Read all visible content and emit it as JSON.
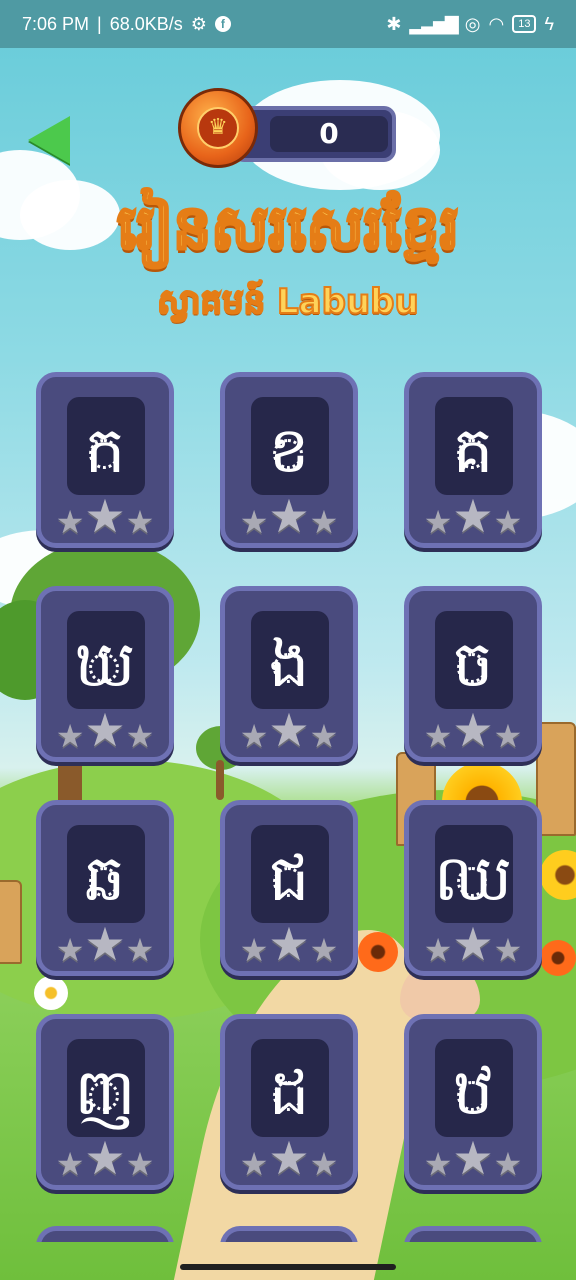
{
  "status_bar": {
    "time": "7:06 PM",
    "separator": "|",
    "speed": "68.0KB/s",
    "icons_left": [
      "gear-icon",
      "facebook-icon"
    ],
    "icons_right": [
      "bluetooth-icon",
      "signal-icon",
      "data-icon",
      "wifi-icon"
    ],
    "battery": "13"
  },
  "header": {
    "back_icon": "back-arrow-icon",
    "coin_icon": "crown-icon",
    "score": "0",
    "title": "រៀនសរសេរខ្មែរ",
    "subtitle": "ស្វាគមន៍ Labubu"
  },
  "cards": [
    {
      "letter": "ក",
      "stars_earned": 0,
      "stars_total": 3
    },
    {
      "letter": "ខ",
      "stars_earned": 0,
      "stars_total": 3
    },
    {
      "letter": "គ",
      "stars_earned": 0,
      "stars_total": 3
    },
    {
      "letter": "ឃ",
      "stars_earned": 0,
      "stars_total": 3
    },
    {
      "letter": "ង",
      "stars_earned": 0,
      "stars_total": 3
    },
    {
      "letter": "ច",
      "stars_earned": 0,
      "stars_total": 3
    },
    {
      "letter": "ឆ",
      "stars_earned": 0,
      "stars_total": 3
    },
    {
      "letter": "ជ",
      "stars_earned": 0,
      "stars_total": 3
    },
    {
      "letter": "ឈ",
      "stars_earned": 0,
      "stars_total": 3
    },
    {
      "letter": "ញ",
      "stars_earned": 0,
      "stars_total": 3
    },
    {
      "letter": "ដ",
      "stars_earned": 0,
      "stars_total": 3
    },
    {
      "letter": "ឋ",
      "stars_earned": 0,
      "stars_total": 3
    }
  ],
  "colors": {
    "card_bg": "#4a4b7e",
    "card_border": "#6e71b4",
    "title": "#ffd35a",
    "back": "#4cc94c"
  }
}
